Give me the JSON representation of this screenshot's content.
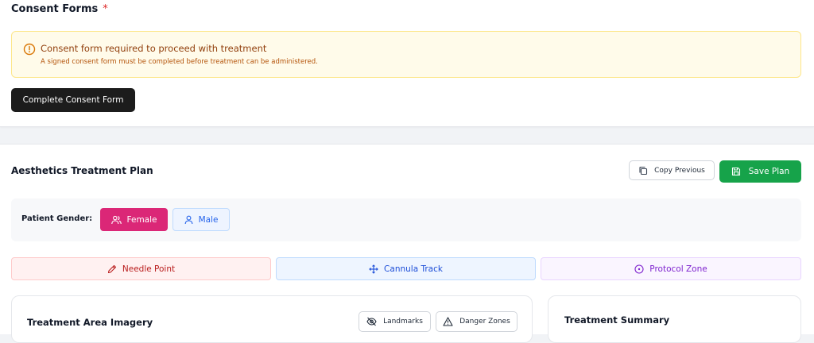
{
  "consent": {
    "title": "Consent Forms",
    "required_marker": "*",
    "alert_title": "Consent form required to proceed with treatment",
    "alert_description": "A signed consent form must be completed before treatment can be administered.",
    "complete_button": "Complete Consent Form",
    "alert_icon": "alert-circle-icon"
  },
  "plan": {
    "title": "Aesthetics Treatment Plan",
    "copy_previous_label": "Copy Previous",
    "save_label": "Save Plan",
    "gender": {
      "label": "Patient Gender:",
      "options": [
        {
          "label": "Female",
          "selected": true,
          "icon": "users-icon"
        },
        {
          "label": "Male",
          "selected": false,
          "icon": "user-icon"
        }
      ]
    },
    "tools": [
      {
        "label": "Needle Point",
        "icon": "pen-icon"
      },
      {
        "label": "Cannula Track",
        "icon": "move-icon"
      },
      {
        "label": "Protocol Zone",
        "icon": "target-icon"
      }
    ],
    "imagery": {
      "title": "Treatment Area Imagery",
      "landmarks_label": "Landmarks",
      "danger_zones_label": "Danger Zones"
    },
    "summary": {
      "title": "Treatment Summary"
    }
  },
  "colors": {
    "save_green": "#16a34a",
    "female_pink": "#db2777",
    "alert_bg": "#fffbea"
  }
}
